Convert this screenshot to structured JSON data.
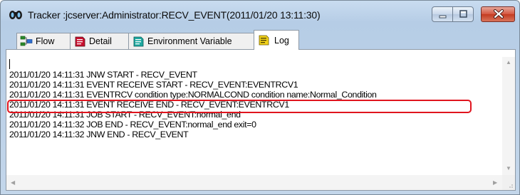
{
  "window": {
    "title": "Tracker :jcserver:Administrator:RECV_EVENT(2011/01/20 13:11:30)",
    "app_icon": "binoculars-icon",
    "controls": [
      "minimize-icon",
      "maximize-icon",
      "close-icon"
    ]
  },
  "tabs": [
    {
      "label": "Flow",
      "icon": "flow-icon",
      "active": false
    },
    {
      "label": "Detail",
      "icon": "detail-icon",
      "active": false
    },
    {
      "label": "Environment Variable",
      "icon": "environment-variable-icon",
      "active": false
    },
    {
      "label": "Log",
      "icon": "log-icon",
      "active": true
    }
  ],
  "log": {
    "lines": [
      "2011/01/20 14:11:31 JNW START - RECV_EVENT",
      "2011/01/20 14:11:31 EVENT RECEIVE START - RECV_EVENT:EVENTRCV1",
      "2011/01/20 14:11:31 EVENTRCV condition type:NORMALCOND condition name:Normal_Condition",
      "2011/01/20 14:11:31 EVENT RECEIVE END - RECV_EVENT:EVENTRCV1",
      "2011/01/20 14:11:31 JOB START - RECV_EVENT:normal_end",
      "2011/01/20 14:11:32 JOB END - RECV_EVENT:normal_end exit=0",
      "2011/01/20 14:11:32 JNW END - RECV_EVENT"
    ],
    "highlighted_line_index": 2
  },
  "colors": {
    "highlight_border": "#e0141e",
    "titlebar": "#c3d6ea"
  }
}
